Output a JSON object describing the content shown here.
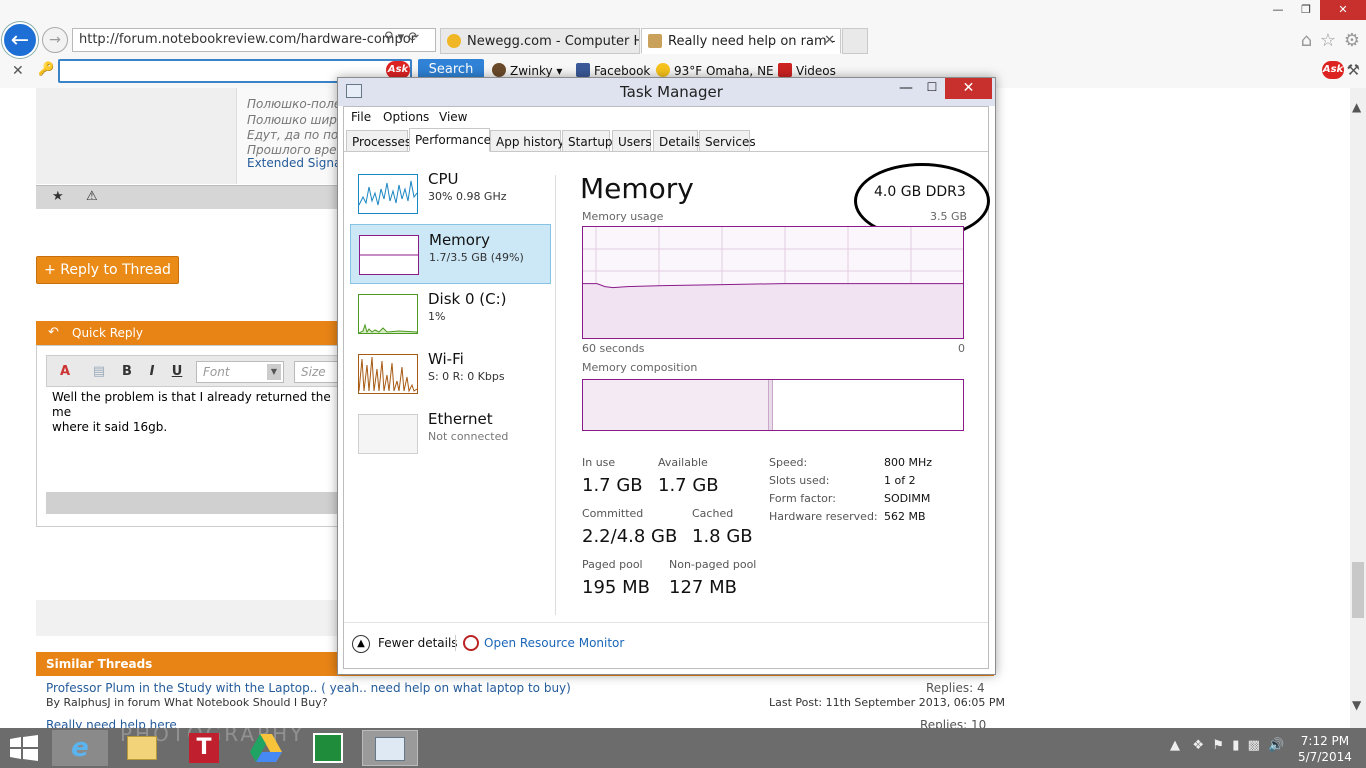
{
  "browser": {
    "address": "http://forum.notebookreview.com/hardware-compor",
    "tabs": [
      {
        "label": "Newegg.com - Computer Har..."
      },
      {
        "label": "Really need help on ram - P...",
        "close": "✕"
      }
    ],
    "search_button": "Search",
    "toolbar": {
      "zwinky": "Zwinky",
      "facebook": "Facebook",
      "weather": "93°F Omaha, NE",
      "videos": "Videos"
    },
    "ask": "Ask"
  },
  "forum": {
    "sig_lines": [
      "Полюшко-поле",
      "Полюшко широ",
      "Едут, да по пол",
      "Прошлого врем"
    ],
    "sig_link": "Extended Signat",
    "reply_button": "+ Reply to Thread",
    "quick_reply_title": "Quick Reply",
    "editor": {
      "font_placeholder": "Font",
      "size_placeholder": "Size",
      "bold": "B",
      "italic": "I",
      "underline": "U",
      "text_line1": "Well the problem is that I already returned the me",
      "text_line2": "where it said 16gb."
    },
    "similar_title": "Similar Threads",
    "similar": [
      {
        "title": "Professor Plum in the Study with the Laptop.. ( yeah.. need help on what laptop to buy)",
        "sub": "By RalphusJ in forum What Notebook Should I Buy?",
        "replies": "Replies: 4",
        "last_post": "Last Post: 11th September 2013, 06:05 PM"
      },
      {
        "title": "Really need help here",
        "replies": "Replies: 10"
      }
    ]
  },
  "task_manager": {
    "title": "Task Manager",
    "menu": [
      "File",
      "Options",
      "View"
    ],
    "tabs": [
      "Processes",
      "Performance",
      "App history",
      "Startup",
      "Users",
      "Details",
      "Services"
    ],
    "resources": [
      {
        "name": "CPU",
        "sub": "30%  0.98 GHz"
      },
      {
        "name": "Memory",
        "sub": "1.7/3.5 GB (49%)"
      },
      {
        "name": "Disk 0 (C:)",
        "sub": "1%"
      },
      {
        "name": "Wi-Fi",
        "sub": "S: 0  R: 0 Kbps"
      },
      {
        "name": "Ethernet",
        "sub": "Not connected"
      }
    ],
    "memory": {
      "title": "Memory",
      "spec": "4.0 GB DDR3",
      "usage_label": "Memory usage",
      "usage_max": "3.5 GB",
      "graph_start": "60 seconds",
      "graph_end": "0",
      "composition_label": "Memory composition",
      "in_use_label": "In use",
      "in_use": "1.7 GB",
      "available_label": "Available",
      "available": "1.7 GB",
      "committed_label": "Committed",
      "committed": "2.2/4.8 GB",
      "cached_label": "Cached",
      "cached": "1.8 GB",
      "paged_label": "Paged pool",
      "paged": "195 MB",
      "nonpaged_label": "Non-paged pool",
      "nonpaged": "127 MB",
      "specs": [
        {
          "label": "Speed:",
          "value": "800 MHz"
        },
        {
          "label": "Slots used:",
          "value": "1 of 2"
        },
        {
          "label": "Form factor:",
          "value": "SODIMM"
        },
        {
          "label": "Hardware reserved:",
          "value": "562 MB"
        }
      ],
      "usage_fraction": 0.49
    },
    "footer": {
      "fewer": "Fewer details",
      "monitor": "Open Resource Monitor"
    }
  },
  "taskbar": {
    "time": "7:12 PM",
    "date": "5/7/2014"
  },
  "colors": {
    "accent": "#e88416",
    "mem_line": "#8b1a8b",
    "link": "#245b9a"
  }
}
